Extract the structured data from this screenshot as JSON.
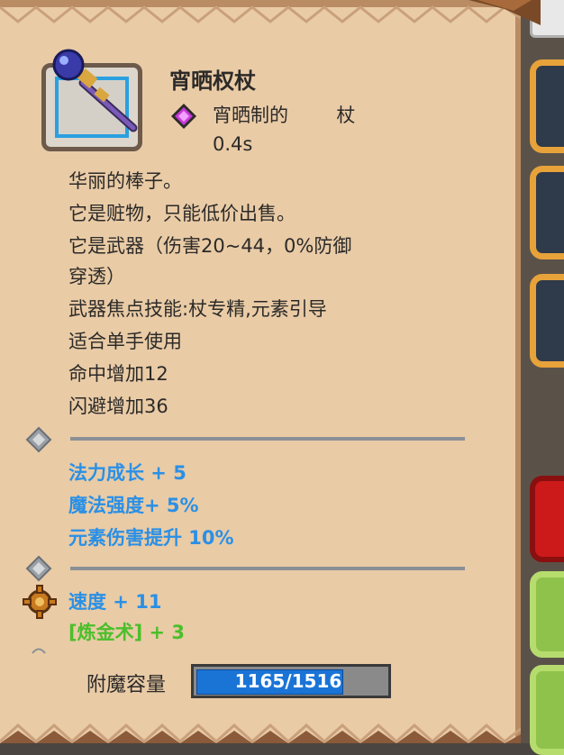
{
  "item": {
    "name": "宵晒权杖",
    "type_text": "宵晒制的        杖",
    "speed": "0.4s",
    "icon": "magic-staff-icon",
    "gem_icon": "purple-gem-diamond-icon"
  },
  "description": [
    "华丽的棒子。",
    "它是赃物，只能低价出售。",
    "它是武器（伤害20~44，0%防御",
    "穿透）",
    "武器焦点技能:杖专精,元素引导",
    "适合单手使用",
    "命中增加12",
    "闪避增加36"
  ],
  "magic_stats": [
    "法力成长 + 5",
    "魔法强度+ 5%",
    "元素伤害提升 10%"
  ],
  "bonus_stats": {
    "speed": "速度 + 11",
    "alchemy": "[炼金术] + 3"
  },
  "enchant": {
    "label": "附魔容量",
    "value_text": "1165/1516",
    "current": 1165,
    "max": 1516
  },
  "colors": {
    "parchment": "#e9cba6",
    "stat_blue": "#2a90e6",
    "stat_green": "#4bbf2a",
    "bar_blue": "#1a74d6"
  }
}
